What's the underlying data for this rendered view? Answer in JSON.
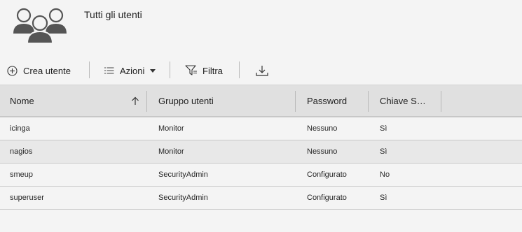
{
  "header": {
    "title": "Tutti gli utenti",
    "icon": "users-group-icon"
  },
  "toolbar": {
    "create_label": "Crea utente",
    "actions_label": "Azioni",
    "filter_label": "Filtra",
    "download_icon": "download-icon"
  },
  "table": {
    "columns": {
      "name": "Nome",
      "group": "Gruppo utenti",
      "password": "Password",
      "key": "Chiave S…"
    },
    "sort": "ascending",
    "rows": [
      {
        "name": "icinga",
        "group": "Monitor",
        "password": "Nessuno",
        "key": "Sì"
      },
      {
        "name": "nagios",
        "group": "Monitor",
        "password": "Nessuno",
        "key": "Sì"
      },
      {
        "name": "smeup",
        "group": "SecurityAdmin",
        "password": "Configurato",
        "key": "No"
      },
      {
        "name": "superuser",
        "group": "SecurityAdmin",
        "password": "Configurato",
        "key": "Sì"
      }
    ]
  },
  "colors": {
    "background": "#f4f4f4",
    "header_row": "#e0e0e0",
    "selected_row": "#e8e8e8",
    "icon_gray": "#555555"
  }
}
